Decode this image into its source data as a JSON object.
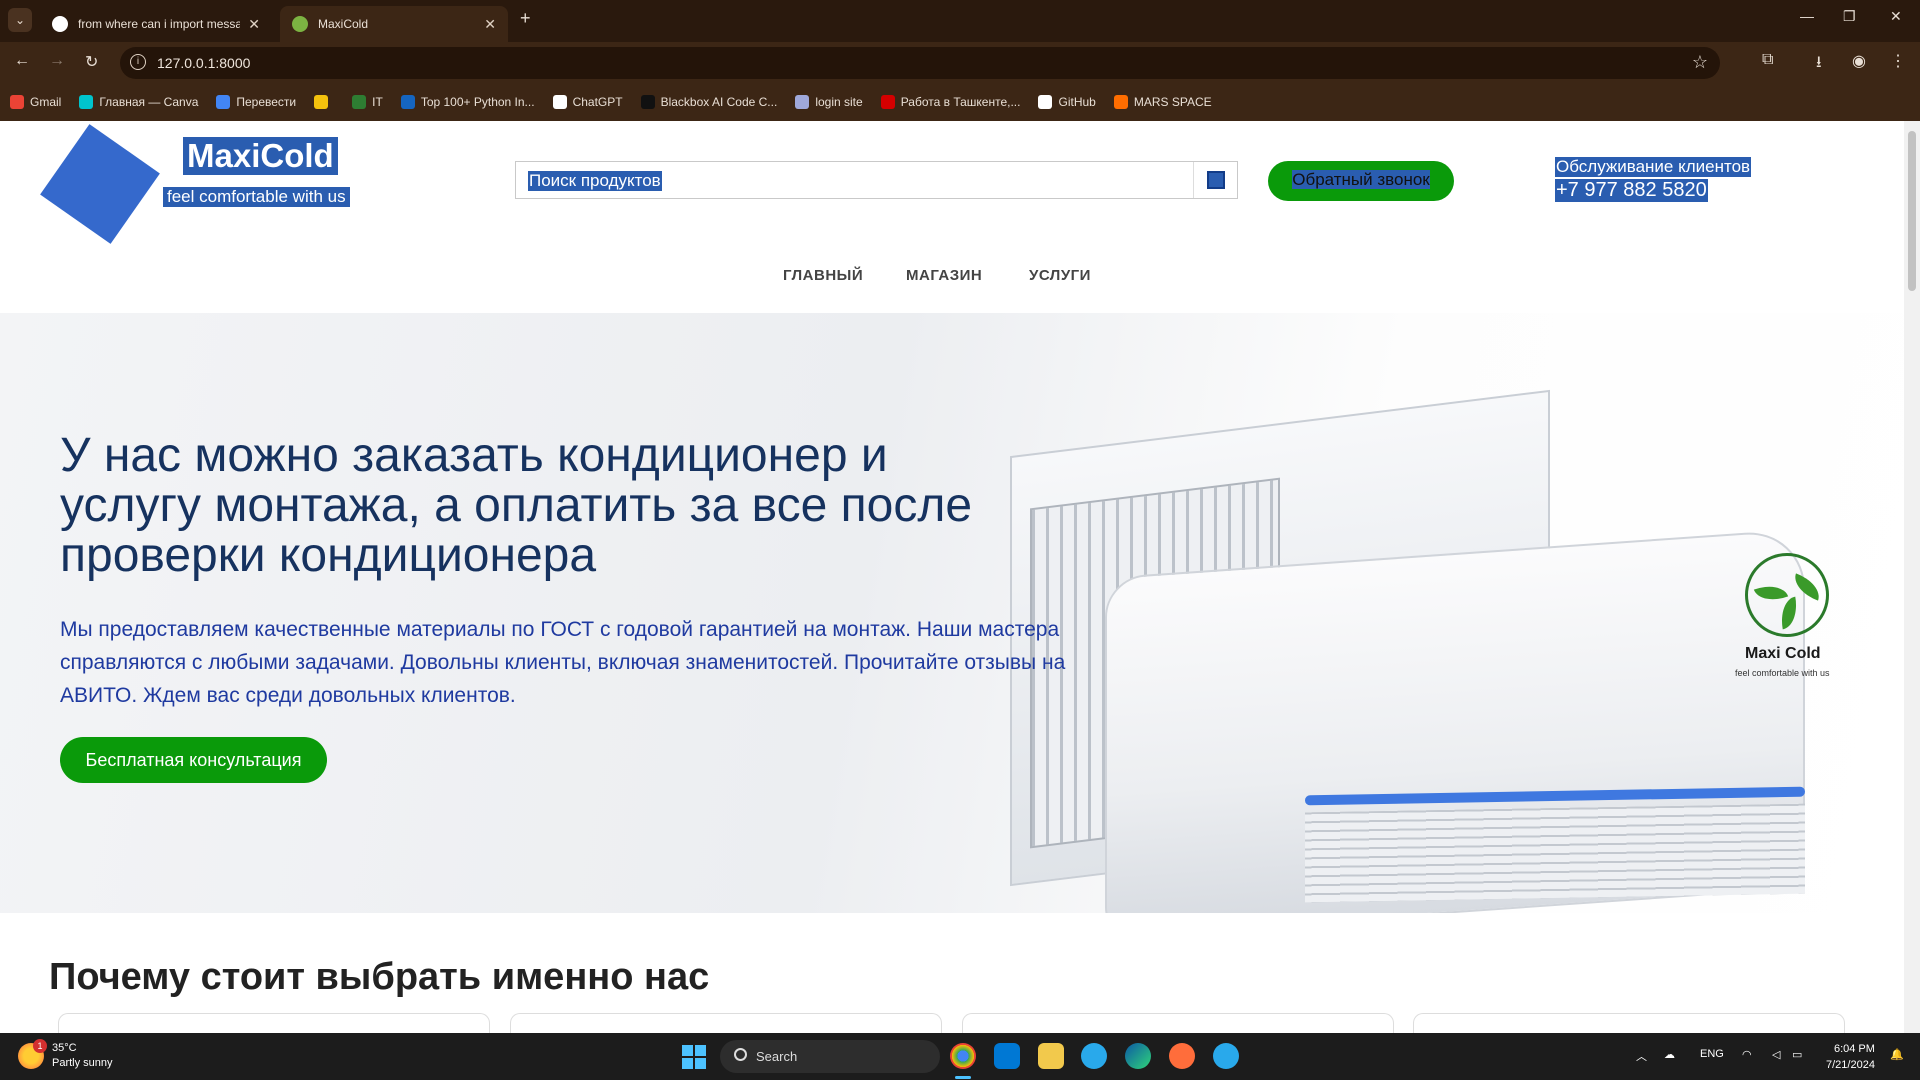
{
  "browser": {
    "tabs": [
      {
        "title": "from where can i import messa",
        "active": false
      },
      {
        "title": "MaxiCold",
        "active": true
      }
    ],
    "url": "127.0.0.1:8000",
    "bookmarks": [
      {
        "label": "Gmail",
        "color": "#ea4335"
      },
      {
        "label": "Главная — Canva",
        "color": "#00c4cc"
      },
      {
        "label": "Перевести",
        "color": "#4285f4"
      },
      {
        "label": "",
        "color": "#f4c20d"
      },
      {
        "label": "IT",
        "color": "#2e7d32"
      },
      {
        "label": "Top 100+ Python In...",
        "color": "#1565c0"
      },
      {
        "label": "ChatGPT",
        "color": "#ffffff"
      },
      {
        "label": "Blackbox AI Code C...",
        "color": "#111111"
      },
      {
        "label": "login site",
        "color": "#9fa8da"
      },
      {
        "label": "Работа в Ташкенте,...",
        "color": "#d50000"
      },
      {
        "label": "GitHub",
        "color": "#ffffff"
      },
      {
        "label": "MARS SPACE",
        "color": "#ff6d00"
      }
    ]
  },
  "site": {
    "logo": {
      "title": "MaxiCold",
      "subtitle": "feel comfortable with us"
    },
    "search": {
      "placeholder": "Поиск продуктов"
    },
    "callback_button": "Обратный звонок",
    "customer_service": {
      "label": "Обслуживание клиентов",
      "phone": "+7 977 882 5820"
    },
    "nav": [
      "ГЛАВНЫЙ",
      "МАГАЗИН",
      "УСЛУГИ"
    ],
    "hero": {
      "heading": "У нас можно заказать кондиционер и услугу монтажа, а оплатить за все после проверки кондиционера",
      "text": "Мы предоставляем качественные материалы по ГОСТ с годовой гарантией на монтаж. Наши мастера справляются с любыми задачами. Довольны клиенты, включая знаменитостей. Прочитайте отзывы на АВИТО. Ждем вас среди довольных клиентов.",
      "button": "Бесплатная консультация",
      "brand_name": "Maxi Cold",
      "brand_tag": "feel comfortable with us"
    },
    "why_heading": "Почему стоит выбрать именно нас",
    "colors": {
      "accent": "#0a9a0a",
      "brand_blue": "#3569cc",
      "heading": "#16325f"
    }
  },
  "taskbar": {
    "weather": {
      "temp": "35°C",
      "desc": "Partly sunny",
      "badge": "1"
    },
    "search_label": "Search",
    "language": "ENG",
    "time": "6:04 PM",
    "date": "7/21/2024"
  }
}
